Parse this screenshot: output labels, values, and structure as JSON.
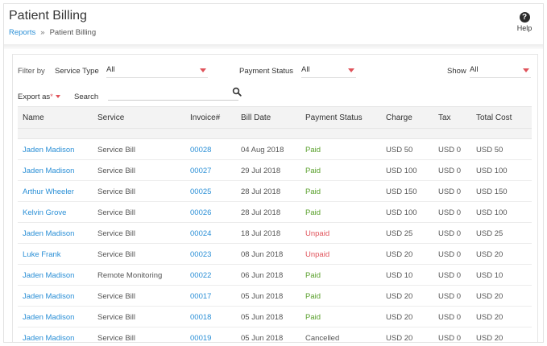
{
  "page": {
    "title": "Patient Billing",
    "breadcrumb": {
      "root": "Reports",
      "separator": "»",
      "current": "Patient Billing"
    },
    "help_label": "Help"
  },
  "filters": {
    "filter_by_label": "Filter by",
    "service_type_label": "Service Type",
    "service_type_value": "All",
    "payment_status_label": "Payment Status",
    "payment_status_value": "All",
    "show_label": "Show",
    "show_value": "All"
  },
  "toolbar": {
    "export_label": "Export as",
    "export_star": "*",
    "search_label": "Search",
    "search_value": ""
  },
  "table": {
    "columns": [
      "Name",
      "Service",
      "Invoice#",
      "Bill Date",
      "Payment Status",
      "Charge",
      "Tax",
      "Total Cost"
    ],
    "rows": [
      {
        "name": "Jaden Madison",
        "service": "Service Bill",
        "invoice": "00028",
        "date": "04 Aug 2018",
        "status": "Paid",
        "charge": "USD 50",
        "tax": "USD 0",
        "total": "USD 50"
      },
      {
        "name": "Jaden Madison",
        "service": "Service Bill",
        "invoice": "00027",
        "date": "29 Jul 2018",
        "status": "Paid",
        "charge": "USD 100",
        "tax": "USD 0",
        "total": "USD 100"
      },
      {
        "name": "Arthur Wheeler",
        "service": "Service Bill",
        "invoice": "00025",
        "date": "28 Jul 2018",
        "status": "Paid",
        "charge": "USD 150",
        "tax": "USD 0",
        "total": "USD 150"
      },
      {
        "name": "Kelvin Grove",
        "service": "Service Bill",
        "invoice": "00026",
        "date": "28 Jul 2018",
        "status": "Paid",
        "charge": "USD 100",
        "tax": "USD 0",
        "total": "USD 100"
      },
      {
        "name": "Jaden Madison",
        "service": "Service Bill",
        "invoice": "00024",
        "date": "18 Jul 2018",
        "status": "Unpaid",
        "charge": "USD 25",
        "tax": "USD 0",
        "total": "USD 25"
      },
      {
        "name": "Luke Frank",
        "service": "Service Bill",
        "invoice": "00023",
        "date": "08 Jun 2018",
        "status": "Unpaid",
        "charge": "USD 20",
        "tax": "USD 0",
        "total": "USD 20"
      },
      {
        "name": "Jaden Madison",
        "service": "Remote Monitoring",
        "invoice": "00022",
        "date": "06 Jun 2018",
        "status": "Paid",
        "charge": "USD 10",
        "tax": "USD 0",
        "total": "USD 10"
      },
      {
        "name": "Jaden Madison",
        "service": "Service Bill",
        "invoice": "00017",
        "date": "05 Jun 2018",
        "status": "Paid",
        "charge": "USD 20",
        "tax": "USD 0",
        "total": "USD 20"
      },
      {
        "name": "Jaden Madison",
        "service": "Service Bill",
        "invoice": "00018",
        "date": "05 Jun 2018",
        "status": "Paid",
        "charge": "USD 20",
        "tax": "USD 0",
        "total": "USD 20"
      },
      {
        "name": "Jaden Madison",
        "service": "Service Bill",
        "invoice": "00019",
        "date": "05 Jun 2018",
        "status": "Cancelled",
        "charge": "USD 20",
        "tax": "USD 0",
        "total": "USD 20"
      }
    ]
  },
  "colors": {
    "link": "#2a8fd6",
    "paid": "#5aa02c",
    "unpaid": "#e0525a",
    "accent_caret": "#e0525a"
  }
}
